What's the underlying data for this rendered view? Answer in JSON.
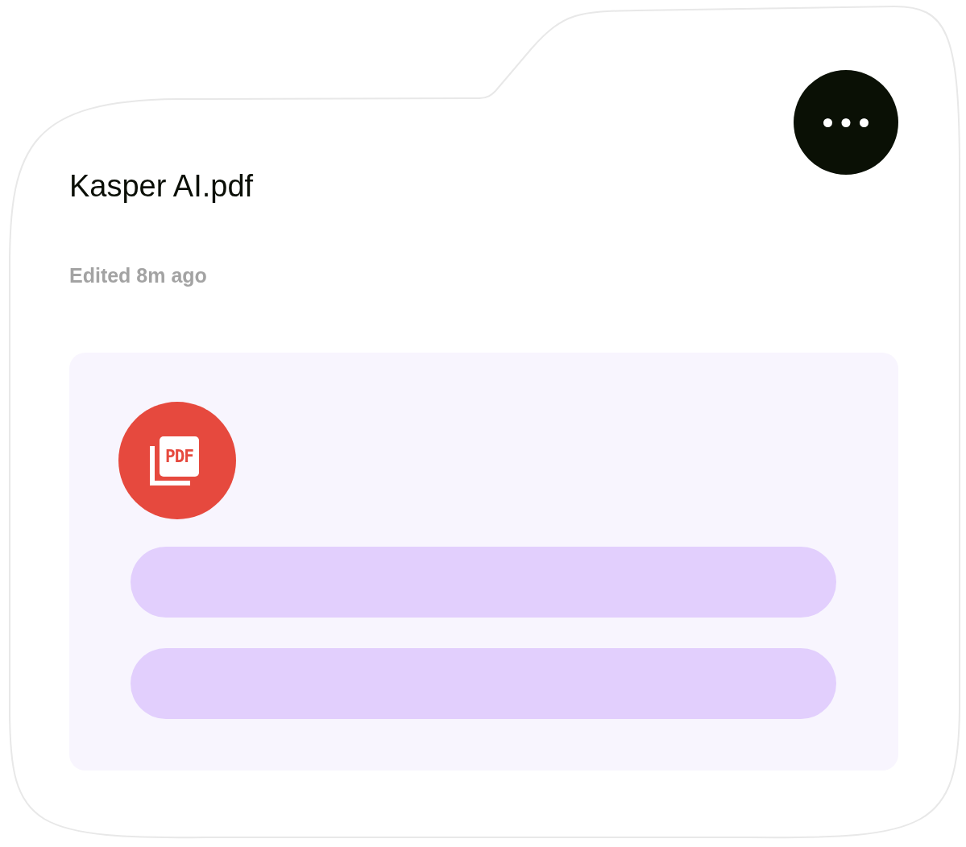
{
  "file": {
    "name": "Kasper AI.pdf",
    "edited": "Edited 8m ago"
  },
  "preview": {
    "file_type": "PDF"
  }
}
